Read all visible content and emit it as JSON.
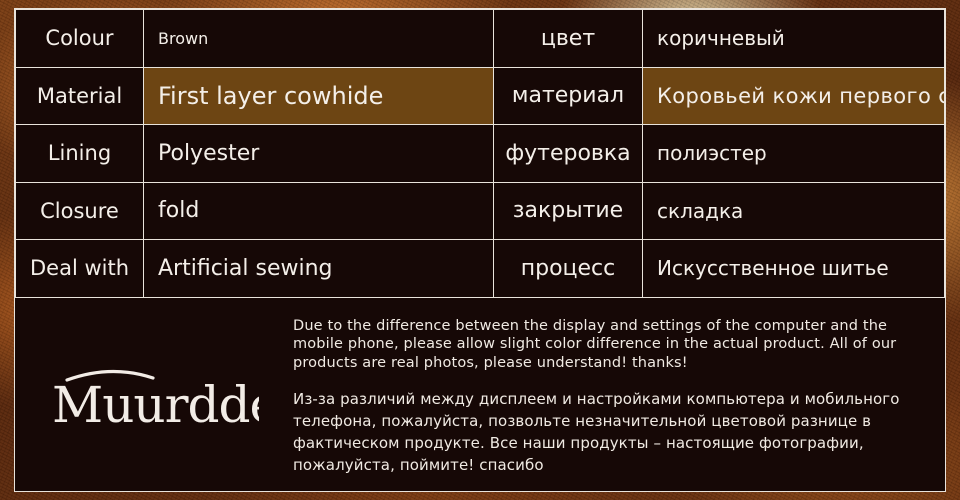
{
  "brand": {
    "name": "Muurdde",
    "logo_icon": "brand-wordmark-with-swash"
  },
  "spec_table": {
    "columns": [
      "label_en",
      "value_en",
      "label_ru",
      "value_ru"
    ],
    "rows": [
      {
        "label_en": "Colour",
        "value_en": "Brown",
        "label_ru": "цвет",
        "value_ru": "коричневый",
        "highlighted": false,
        "value_small": true
      },
      {
        "label_en": "Material",
        "value_en": "First layer cowhide",
        "label_ru": "материал",
        "value_ru": "Коровьей кожи первого слоя",
        "highlighted": true,
        "value_small": false
      },
      {
        "label_en": "Lining",
        "value_en": "Polyester",
        "label_ru": "футеровка",
        "value_ru": "полиэстер",
        "highlighted": false,
        "value_small": false
      },
      {
        "label_en": "Closure",
        "value_en": "fold",
        "label_ru": "закрытие",
        "value_ru": "складка",
        "highlighted": false,
        "value_small": false
      },
      {
        "label_en": "Deal with",
        "value_en": "Artificial sewing",
        "label_ru": "процесс",
        "value_ru": "Искусственное шитье",
        "highlighted": false,
        "value_small": false
      }
    ]
  },
  "disclaimer": {
    "english": "Due to the difference between the display and settings of the computer and the mobile phone, please allow slight color difference in the actual product. All of our products are real photos, please understand! thanks!",
    "russian": "Из-за различий между дисплеем и настройками компьютера и мобильного телефона, пожалуйста, позвольте незначительной цветовой разнице в фактическом продукте. Все наши продукты – настоящие фотографии, пожалуйста, поймите! спасибо"
  },
  "colors": {
    "panel_background": "#160806",
    "panel_border": "#e9e3db",
    "highlight_cell": "#6d4513",
    "text": "#f4efe9",
    "backdrop": "#6d3410"
  }
}
